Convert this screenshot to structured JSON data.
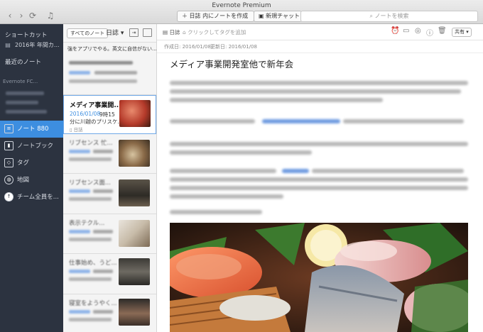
{
  "window": {
    "title": "Evernote Premium"
  },
  "toolbar": {
    "new_note_label": "＋ 日誌 内にノートを作成",
    "new_chat_label": "新規チャット",
    "search_placeholder": "ノートを検索",
    "back_icon": "chevron-left-icon",
    "forward_icon": "chevron-right-icon",
    "sync_icon": "sync-icon",
    "bell_icon": "bell-icon"
  },
  "sidebar": {
    "shortcuts_heading": "ショートカット",
    "shortcut_item": "2016年 年間カ...",
    "recent_heading": "最近のノート",
    "recent_first": "Evernote FC...",
    "nav": [
      {
        "label": "ノート",
        "count": "880",
        "icon": "note-icon"
      },
      {
        "label": "ノートブック",
        "icon": "notebook-icon"
      },
      {
        "label": "タグ",
        "icon": "tag-icon"
      },
      {
        "label": "地図",
        "icon": "globe-icon"
      },
      {
        "label": "チーム全員を...",
        "icon": "add-icon"
      }
    ],
    "accent": "#3d8ee0"
  },
  "notelist": {
    "filter_label": "すべてのノート",
    "notebook_label": "日誌 ▾",
    "top_snippet": "強をアプリでやる。英文に自信がない...",
    "selected_note": {
      "title": "メディア事業開...",
      "date": "2016/01/08",
      "snippet_1": "9時15",
      "snippet_2": "分に川越のプリスケ...",
      "tag": "日誌"
    },
    "other_titles": [
      "リブセンス 忙...",
      "リブセンス面...",
      "表示テクル...",
      "仕事始め、うど...",
      "寝室をようやく..."
    ]
  },
  "editor": {
    "notebook": "日誌",
    "tag_placeholder": "クリックしてタグを追加",
    "created": "作成日: 2016/01/08",
    "updated": "更新日: 2016/01/08",
    "share_label": "共有",
    "title": "メディア事業開発室他で新年会"
  }
}
